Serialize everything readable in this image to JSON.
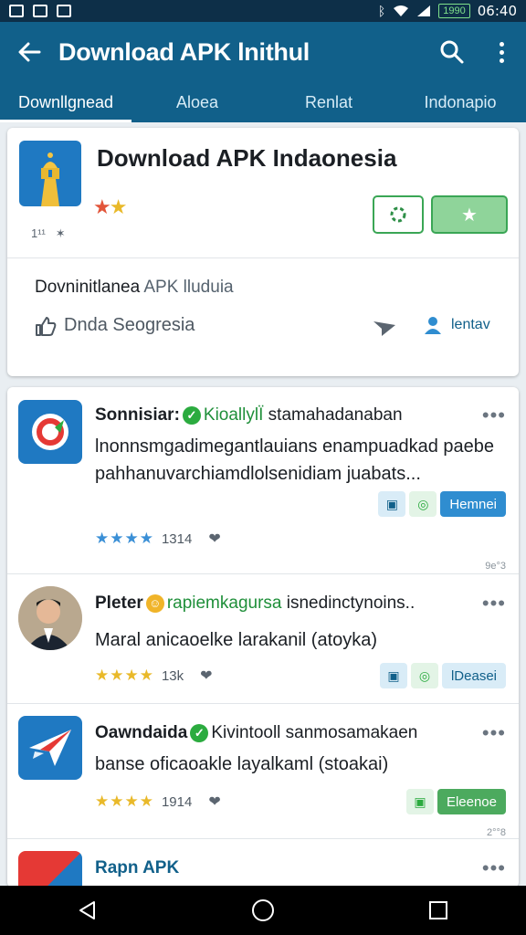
{
  "status": {
    "battery": "1990",
    "time": "06:40"
  },
  "app_bar": {
    "title": "Download APK lnithul"
  },
  "tabs": [
    "Downllgnead",
    "Aloea",
    "Renlat",
    "Indonapio"
  ],
  "header": {
    "title": "Download APK Indaonesia",
    "meta": "1¹¹   ✶",
    "subtitle_dark": "Dovninitlanea",
    "subtitle_light": "APK lluduia",
    "like_text": "Dnda Seogresia",
    "user_text": "lentav"
  },
  "posts": [
    {
      "name": "Sonnisiar:",
      "green": "KioallylÏ",
      "rest": "stamahadanaban",
      "body": "lnonnsmgadimegantlauians enampuadkad paebe pahhanuvarchiamdlolsenidiam juabats...",
      "rating": "1314",
      "action_label": "Hemnei",
      "stamp": "9e°3"
    },
    {
      "name": "Pleter",
      "green": "rapiemkagursa",
      "rest": "isnedinctynoins..",
      "body": "Maral anicaoelke larakanil (atoyka)",
      "rating": "13k",
      "action_label": "lDeasei",
      "stamp": ""
    },
    {
      "name": "Oawndaida",
      "green": "",
      "rest": "Kivintooll sanmosamakaen",
      "body": "banse oficaoakle layalkaml (stoakai)",
      "rating": "1914",
      "action_label": "Eleenoe",
      "stamp": "2°°8"
    },
    {
      "name": "Rapn APK",
      "green": "",
      "rest": "",
      "body": "",
      "rating": "",
      "action_label": "",
      "stamp": ""
    }
  ]
}
